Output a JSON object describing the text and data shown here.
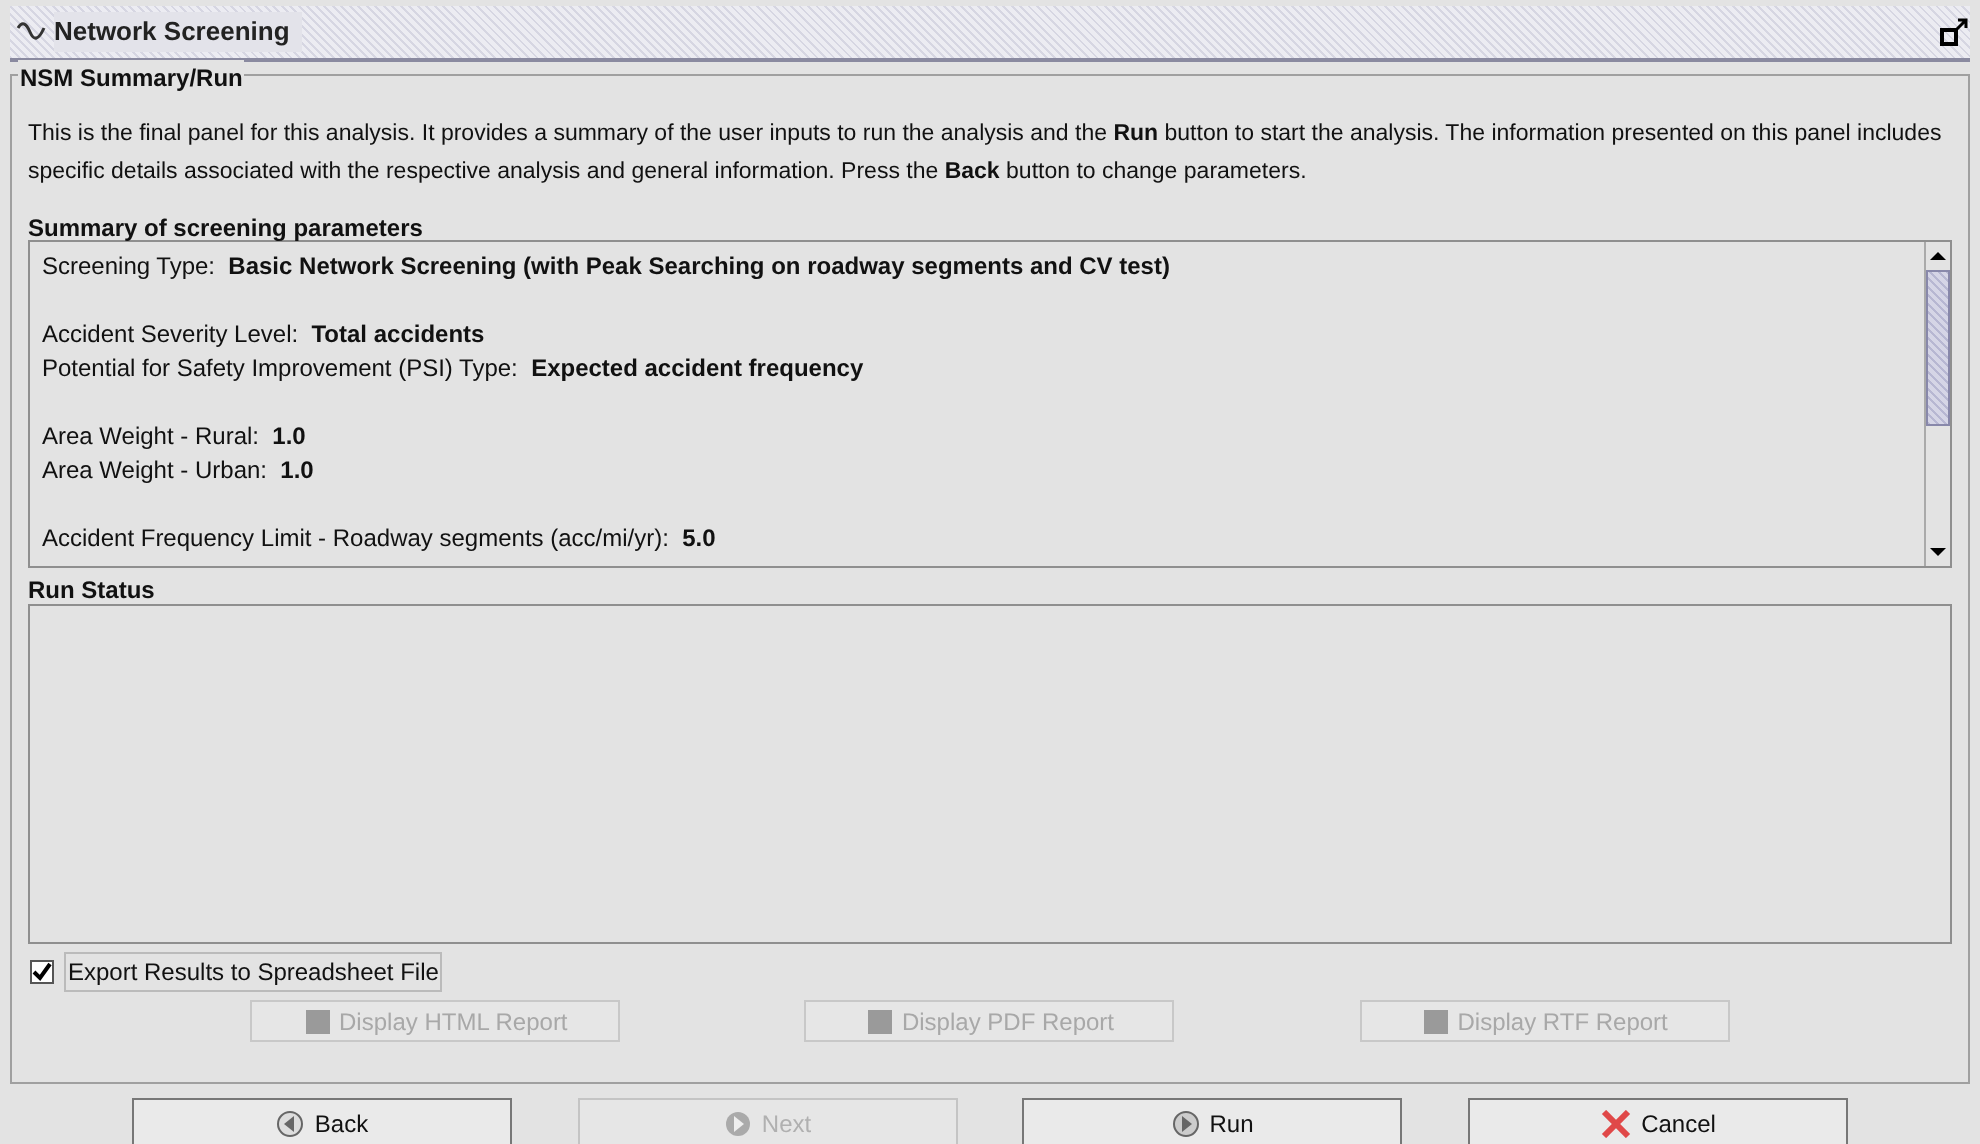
{
  "window": {
    "title": "Network Screening"
  },
  "panel": {
    "title": "NSM Summary/Run",
    "description": "This is the final panel for this analysis. It provides a summary of the user inputs to run the analysis and the **Run** button to start the analysis. The information presented on this panel includes specific details associated with the respective analysis and general information. Press the **Back** button to change parameters."
  },
  "summary": {
    "title": "Summary of screening parameters",
    "groups": [
      [
        {
          "label": "Screening Type:",
          "value": "Basic Network Screening (with Peak Searching on roadway segments and CV test)"
        }
      ],
      [
        {
          "label": "Accident Severity Level:",
          "value": "Total accidents"
        },
        {
          "label": "Potential for Safety Improvement (PSI) Type:",
          "value": "Expected accident frequency"
        }
      ],
      [
        {
          "label": "Area Weight - Rural:",
          "value": "1.0"
        },
        {
          "label": "Area Weight - Urban:",
          "value": "1.0"
        }
      ],
      [
        {
          "label": "Accident Frequency Limit - Roadway segments (acc/mi/yr):",
          "value": "5.0"
        }
      ]
    ]
  },
  "run_status": {
    "title": "Run Status"
  },
  "export_checkbox": {
    "label": "Export Results to Spreadsheet File",
    "checked": true
  },
  "report_buttons": [
    {
      "label": "Display HTML Report",
      "disabled": true
    },
    {
      "label": "Display PDF Report",
      "disabled": true
    },
    {
      "label": "Display RTF Report",
      "disabled": true
    }
  ],
  "nav_buttons": [
    {
      "kind": "back",
      "label": "Back",
      "disabled": false
    },
    {
      "kind": "next",
      "label": "Next",
      "disabled": true
    },
    {
      "kind": "run",
      "label": "Run",
      "disabled": false
    },
    {
      "kind": "cancel",
      "label": "Cancel",
      "disabled": false
    }
  ]
}
